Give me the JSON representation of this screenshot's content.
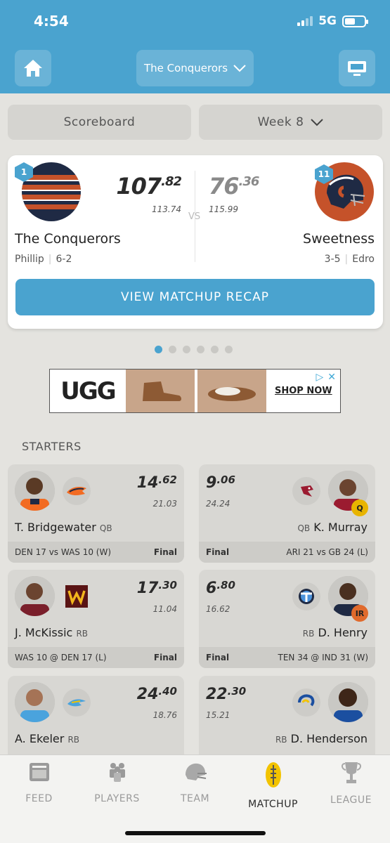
{
  "status": {
    "time": "4:54",
    "network": "5G"
  },
  "header": {
    "team_selector": "The Conquerors"
  },
  "segments": {
    "scoreboard": "Scoreboard",
    "week": "Week 8"
  },
  "matchup": {
    "left": {
      "rank": "1",
      "score_int": "107",
      "score_dec": ".82",
      "projected": "113.74",
      "name": "The Conquerors",
      "owner": "Phillip",
      "record": "6-2"
    },
    "right": {
      "rank": "11",
      "score_int": "76",
      "score_dec": ".36",
      "projected": "115.99",
      "name": "Sweetness",
      "owner": "Edro",
      "record": "3-5"
    },
    "vs": "VS",
    "recap_button": "VIEW MATCHUP RECAP"
  },
  "pager": {
    "count": 6,
    "active_index": 0
  },
  "ad": {
    "brand": "UGG",
    "cta": "SHOP NOW"
  },
  "section_title": "STARTERS",
  "players": [
    {
      "side": "left",
      "name": "T. Bridgewater",
      "pos": "QB",
      "pts_int": "14",
      "pts_dec": ".62",
      "proj": "21.03",
      "game": "DEN 17 vs WAS 10 (W)",
      "status": "Final",
      "team_icon": "broncos-logo-icon"
    },
    {
      "side": "right",
      "name": "K. Murray",
      "pos": "QB",
      "pts_int": "9",
      "pts_dec": ".06",
      "proj": "24.24",
      "game": "ARI 21 vs GB 24 (L)",
      "status": "Final",
      "badge": "Q",
      "team_icon": "cardinals-logo-icon"
    },
    {
      "side": "left",
      "name": "J. McKissic",
      "pos": "RB",
      "pts_int": "17",
      "pts_dec": ".30",
      "proj": "11.04",
      "game": "WAS 10 @ DEN 17 (L)",
      "status": "Final",
      "team_icon": "washington-logo-icon"
    },
    {
      "side": "right",
      "name": "D. Henry",
      "pos": "RB",
      "pts_int": "6",
      "pts_dec": ".80",
      "proj": "16.62",
      "game": "TEN 34 @ IND 31 (W)",
      "status": "Final",
      "badge": "IR",
      "team_icon": "titans-logo-icon"
    },
    {
      "side": "left",
      "name": "A. Ekeler",
      "pos": "RB",
      "pts_int": "24",
      "pts_dec": ".40",
      "proj": "18.76",
      "team_icon": "chargers-logo-icon"
    },
    {
      "side": "right",
      "name": "D. Henderson",
      "pos": "RB",
      "pts_int": "22",
      "pts_dec": ".30",
      "proj": "15.21",
      "team_icon": "rams-logo-icon"
    }
  ],
  "nav": {
    "feed": "FEED",
    "players": "PLAYERS",
    "team": "TEAM",
    "matchup": "MATCHUP",
    "league": "LEAGUE",
    "active": "MATCHUP"
  },
  "colors": {
    "accent": "#4aa3cf",
    "bears_orange": "#c5522a",
    "bears_navy": "#1f2a44",
    "badge_q": "#e8b400",
    "badge_ir": "#e06a2c"
  }
}
